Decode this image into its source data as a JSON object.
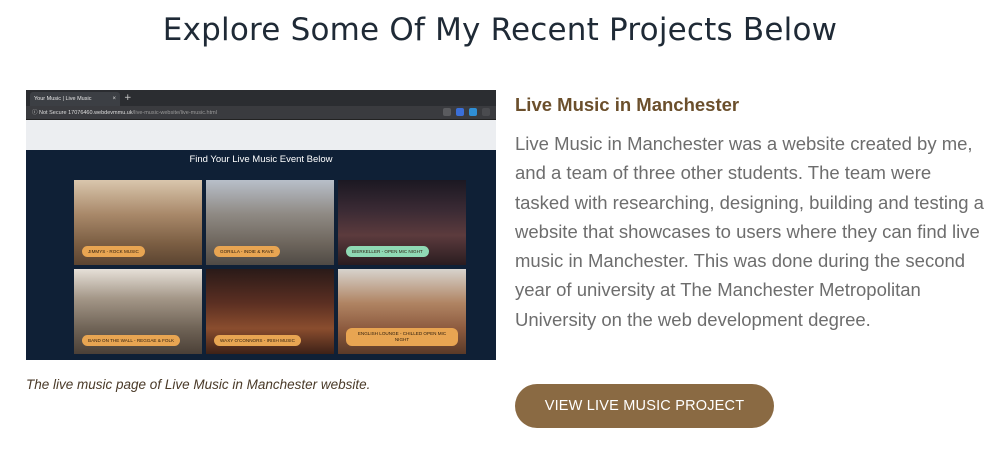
{
  "heading": "Explore Some Of My Recent Projects Below",
  "screenshot": {
    "browser": {
      "tab_title": "Your Music | Live Music",
      "tab_close": "×",
      "new_tab": "+",
      "url_security": "ⓘ Not Secure",
      "url_host": "17076460.webdevmmu.uk",
      "url_path": "/live-music-website/live-music.html"
    },
    "page_title": "Find Your Live Music Event Below",
    "cards": [
      {
        "label": "JIMMYS - ROCK MUSIC"
      },
      {
        "label": "GORILLA - INDIE & RAVE"
      },
      {
        "label": "BIERKELLER - OPEN MIC NIGHT"
      },
      {
        "label": "BAND ON THE WALL - REGGAE & FOLK"
      },
      {
        "label": "WAXY O'CONNORS - IRISH MUSIC"
      },
      {
        "label": "ENGLISH LOUNGE - CHILLED OPEN MIC NIGHT"
      }
    ]
  },
  "caption": "The live music page of Live Music in Manchester website.",
  "project": {
    "title": "Live Music in Manchester",
    "description": "Live Music in Manchester was a website created by me, and a team of three other students. The team were tasked with researching, designing, building and testing a website that showcases to users where they can find live music in Manchester. This was done during the second year of university at The Manchester Metropolitan University on the web development degree.",
    "button_label": "VIEW LIVE MUSIC PROJECT"
  },
  "colors": {
    "accent": "#8a6a43",
    "title": "#6b4f2c",
    "heading": "#1f2a36",
    "pill_orange": "#e8a552",
    "pill_green": "#8fd9b4"
  }
}
